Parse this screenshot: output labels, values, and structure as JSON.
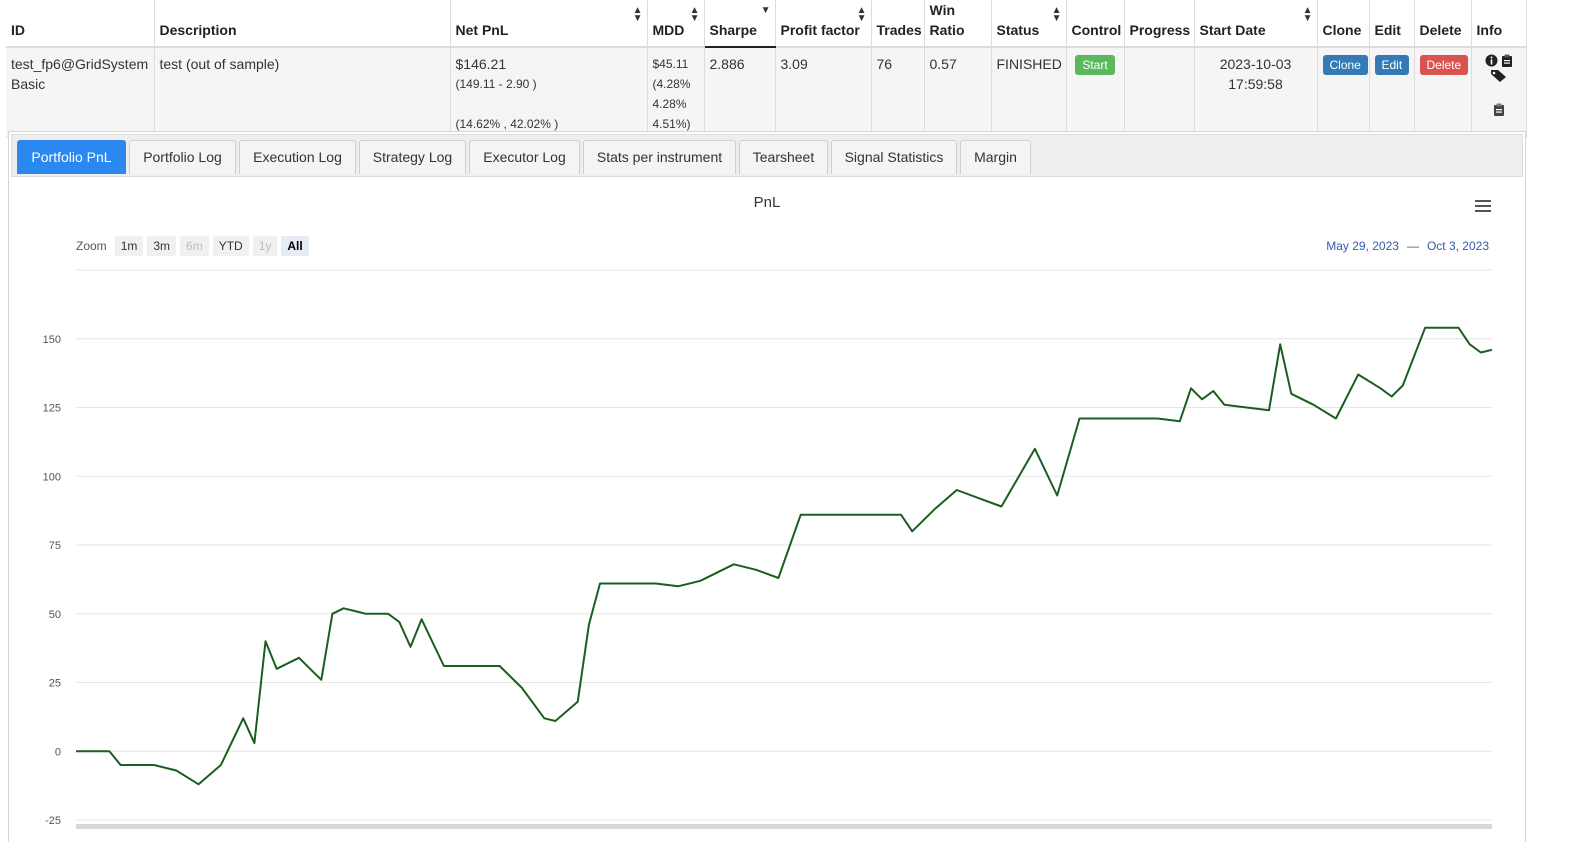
{
  "table": {
    "headers": [
      {
        "label": "ID",
        "sortable": false
      },
      {
        "label": "Description",
        "sortable": false
      },
      {
        "label": "Net PnL",
        "sortable": true
      },
      {
        "label": "MDD",
        "sortable": true
      },
      {
        "label": "Sharpe",
        "sortable": true
      },
      {
        "label": "Profit factor",
        "sortable": true
      },
      {
        "label": "Trades",
        "sortable": false
      },
      {
        "label": "Win Ratio",
        "sortable": false
      },
      {
        "label": "Status",
        "sortable": true
      },
      {
        "label": "Control",
        "sortable": false
      },
      {
        "label": "Progress",
        "sortable": false
      },
      {
        "label": "Start Date",
        "sortable": true
      },
      {
        "label": "Clone",
        "sortable": false
      },
      {
        "label": "Edit",
        "sortable": false
      },
      {
        "label": "Delete",
        "sortable": false
      },
      {
        "label": "Info",
        "sortable": false
      }
    ],
    "row": {
      "id": "test_fp6@GridSystem Basic",
      "description": "test (out of sample)",
      "net_pnl": "$146.21",
      "net_pnl_detail": "(149.11 - 2.90 )",
      "net_pnl_pct": "(14.62% , 42.02% )",
      "mdd": "$45.11",
      "mdd_pct": "(4.28%",
      "mdd_pct2": "4.28%",
      "mdd_pct3": "4.51%)",
      "sharpe": "2.886",
      "profit_factor": "3.09",
      "trades": "76",
      "win_ratio": "0.57",
      "status": "FINISHED",
      "control_button": "Start",
      "progress": "",
      "start_date": "2023-10-03",
      "start_time": "17:59:58",
      "clone_button": "Clone",
      "edit_button": "Edit",
      "delete_button": "Delete"
    }
  },
  "tabs": [
    {
      "label": "Portfolio PnL",
      "active": true
    },
    {
      "label": "Portfolio Log",
      "active": false
    },
    {
      "label": "Execution Log",
      "active": false
    },
    {
      "label": "Strategy Log",
      "active": false
    },
    {
      "label": "Executor Log",
      "active": false
    },
    {
      "label": "Stats per instrument",
      "active": false
    },
    {
      "label": "Tearsheet",
      "active": false
    },
    {
      "label": "Signal Statistics",
      "active": false
    },
    {
      "label": "Margin",
      "active": false
    }
  ],
  "zoom": {
    "label": "Zoom",
    "buttons": [
      {
        "label": "1m",
        "state": "normal"
      },
      {
        "label": "3m",
        "state": "normal"
      },
      {
        "label": "6m",
        "state": "disabled"
      },
      {
        "label": "YTD",
        "state": "normal"
      },
      {
        "label": "1y",
        "state": "disabled"
      },
      {
        "label": "All",
        "state": "active"
      }
    ],
    "range_from": "May 29, 2023",
    "range_to": "Oct 3, 2023"
  },
  "colors": {
    "line": "#1b5e20",
    "accent": "#2b88f0"
  },
  "icons": [
    "menu-icon",
    "info-icon",
    "clipboard-icon",
    "tag-icon"
  ],
  "chart_data": {
    "type": "line",
    "title": "PnL",
    "xlabel": "",
    "ylabel": "",
    "x_range": [
      "2023-05-29",
      "2023-10-03"
    ],
    "y_ticks": [
      -25,
      0,
      25,
      50,
      75,
      100,
      125,
      150
    ],
    "ylim": [
      -25,
      175
    ],
    "grid": true,
    "legend": "none",
    "series": [
      {
        "x": [
          "2023-05-29",
          "2023-06-01",
          "2023-06-02",
          "2023-06-05",
          "2023-06-07",
          "2023-06-09",
          "2023-06-11",
          "2023-06-13",
          "2023-06-14",
          "2023-06-15",
          "2023-06-16",
          "2023-06-18",
          "2023-06-19",
          "2023-06-20",
          "2023-06-21",
          "2023-06-22",
          "2023-06-23",
          "2023-06-24",
          "2023-06-26",
          "2023-06-27",
          "2023-06-28",
          "2023-06-29",
          "2023-07-01",
          "2023-07-03",
          "2023-07-06",
          "2023-07-08",
          "2023-07-10",
          "2023-07-11",
          "2023-07-13",
          "2023-07-14",
          "2023-07-15",
          "2023-07-16",
          "2023-07-18",
          "2023-07-20",
          "2023-07-22",
          "2023-07-24",
          "2023-07-27",
          "2023-07-29",
          "2023-07-31",
          "2023-08-02",
          "2023-08-04",
          "2023-08-07",
          "2023-08-09",
          "2023-08-11",
          "2023-08-12",
          "2023-08-14",
          "2023-08-16",
          "2023-08-18",
          "2023-08-20",
          "2023-08-23",
          "2023-08-25",
          "2023-08-27",
          "2023-08-30",
          "2023-09-01",
          "2023-09-03",
          "2023-09-05",
          "2023-09-06",
          "2023-09-07",
          "2023-09-08",
          "2023-09-09",
          "2023-09-11",
          "2023-09-13",
          "2023-09-14",
          "2023-09-15",
          "2023-09-17",
          "2023-09-19",
          "2023-09-21",
          "2023-09-23",
          "2023-09-24",
          "2023-09-25",
          "2023-09-27",
          "2023-09-28",
          "2023-09-29",
          "2023-09-30",
          "2023-10-01",
          "2023-10-02",
          "2023-10-03"
        ],
        "y": [
          0,
          0,
          -5,
          -5,
          -7,
          -12,
          -5,
          12,
          3,
          40,
          30,
          34,
          30,
          26,
          50,
          52,
          51,
          50,
          50,
          47,
          38,
          48,
          31,
          31,
          31,
          23,
          12,
          11,
          18,
          46,
          61,
          61,
          61,
          61,
          60,
          62,
          68,
          66,
          63,
          86,
          86,
          86,
          86,
          86,
          80,
          88,
          95,
          92,
          89,
          110,
          93,
          121,
          121,
          121,
          121,
          120,
          132,
          128,
          131,
          126,
          125,
          124,
          148,
          130,
          126,
          121,
          137,
          132,
          129,
          133,
          154,
          154,
          154,
          154,
          148,
          145,
          146
        ]
      }
    ]
  }
}
